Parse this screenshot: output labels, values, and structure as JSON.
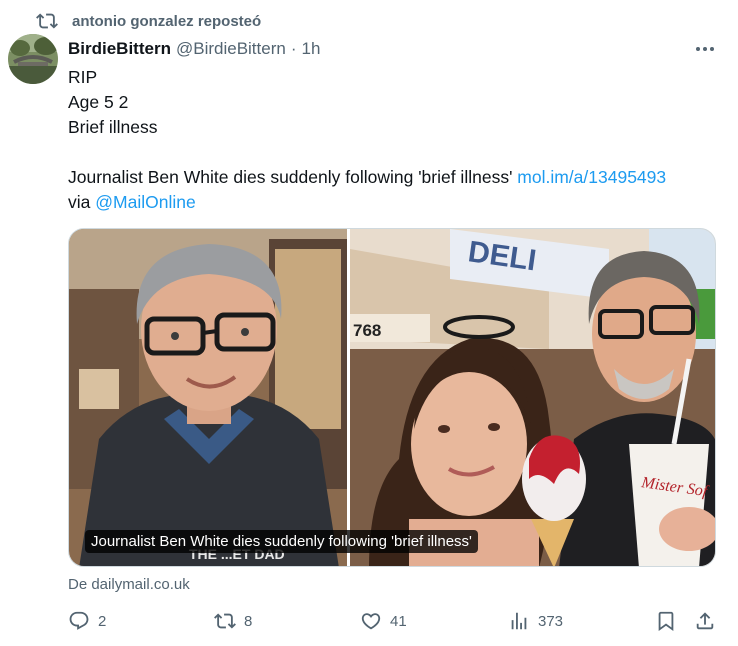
{
  "repost": {
    "icon": "repost-icon",
    "text": "antonio gonzalez reposteó"
  },
  "post": {
    "display_name": "BirdieBittern",
    "handle": "@BirdieBittern",
    "separator": "·",
    "time": "1h",
    "lines": [
      "RIP",
      "Age 5 2",
      "Brief illness"
    ],
    "headline_text": "Journalist Ben White dies suddenly following 'brief illness'",
    "headline_link": "mol.im/a/13495493",
    "via_text": "via",
    "via_mention": "@MailOnline"
  },
  "media": {
    "caption": "Journalist Ben White dies suddenly following 'brief illness'",
    "sign_deli": "DELI",
    "address_number": "768",
    "cup_text": "Mister Sof",
    "shirt_text": "THE ...ET DAD"
  },
  "card_source": "De dailymail.co.uk",
  "actions": {
    "reply_count": "2",
    "repost_count": "8",
    "like_count": "41",
    "views_count": "373"
  },
  "colors": {
    "accent": "#1d9bf0",
    "secondary_text": "#536471",
    "primary_text": "#0f1419"
  }
}
